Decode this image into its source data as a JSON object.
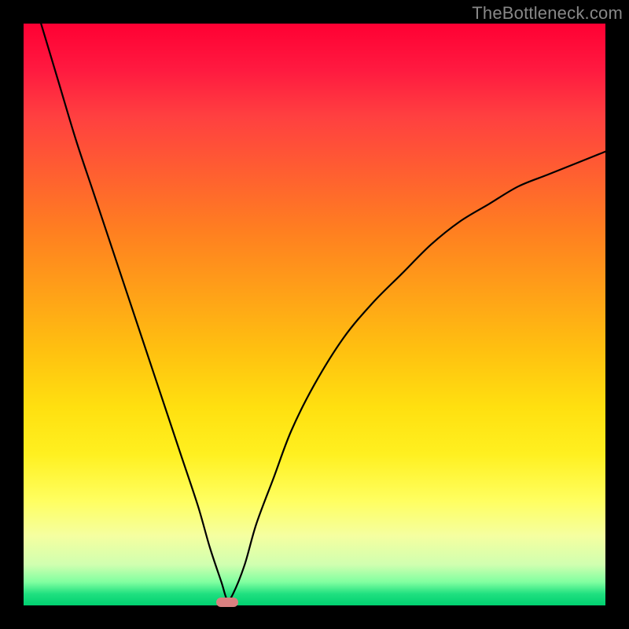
{
  "attribution": "TheBottleneck.com",
  "chart_data": {
    "type": "line",
    "title": "",
    "xlabel": "",
    "ylabel": "",
    "xlim": [
      0,
      100
    ],
    "ylim": [
      0,
      100
    ],
    "x": [
      3,
      6,
      9,
      12,
      15,
      18,
      21,
      24,
      27,
      30,
      32,
      34,
      35,
      36,
      38,
      40,
      43,
      46,
      50,
      55,
      60,
      65,
      70,
      75,
      80,
      85,
      90,
      95,
      100
    ],
    "y": [
      100,
      90,
      80,
      71,
      62,
      53,
      44,
      35,
      26,
      17,
      10,
      4,
      1,
      2,
      7,
      14,
      22,
      30,
      38,
      46,
      52,
      57,
      62,
      66,
      69,
      72,
      74,
      76,
      78
    ],
    "marker": {
      "x": 35,
      "y": 0.5
    },
    "background_gradient": {
      "top_color": "#ff0033",
      "mid_color": "#ffe010",
      "bottom_color": "#00d070"
    }
  }
}
